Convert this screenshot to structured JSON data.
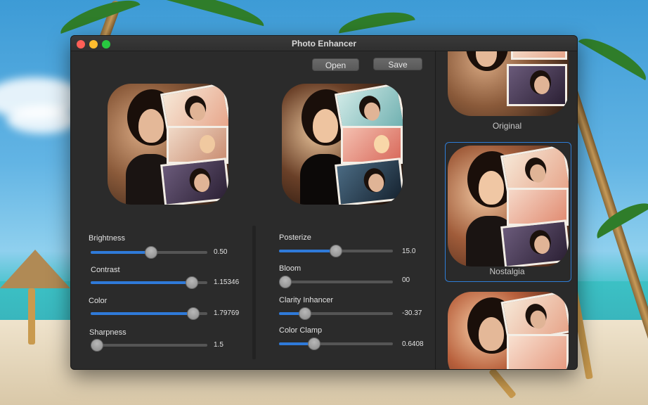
{
  "window": {
    "title": "Photo Enhancer"
  },
  "toolbar": {
    "open_label": "Open",
    "save_label": "Save"
  },
  "adjustments_left": [
    {
      "label": "Brightness",
      "value": "0.50",
      "fraction": 0.52
    },
    {
      "label": "Contrast",
      "value": "1.15346",
      "fraction": 0.87
    },
    {
      "label": "Color",
      "value": "1.79769",
      "fraction": 0.88
    },
    {
      "label": "Sharpness",
      "value": "1.5",
      "fraction": 0.05
    }
  ],
  "adjustments_right": [
    {
      "label": "Posterize",
      "value": "15.0",
      "fraction": 0.5
    },
    {
      "label": "Bloom",
      "value": "00",
      "fraction": 0.05
    },
    {
      "label": "Clarity Inhancer",
      "value": "-30.37",
      "fraction": 0.23
    },
    {
      "label": "Color Clamp",
      "value": "0.6408",
      "fraction": 0.31
    }
  ],
  "filters": [
    {
      "label": "Original",
      "selected": false
    },
    {
      "label": "Nostalgia",
      "selected": true
    },
    {
      "label": "",
      "selected": false
    }
  ],
  "colors": {
    "accent": "#2f7ad9",
    "selection": "#2e7dd6"
  }
}
